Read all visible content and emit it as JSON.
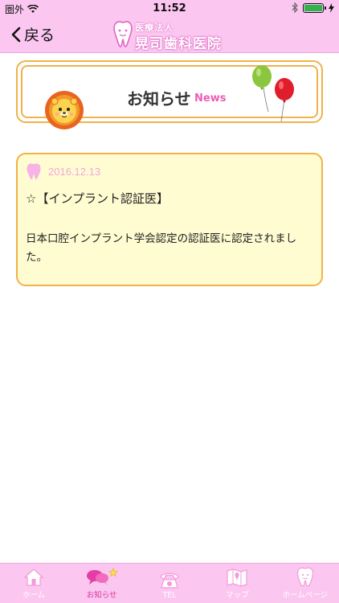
{
  "status_bar": {
    "carrier": "圏外",
    "time": "11:52"
  },
  "nav": {
    "back_label": "戻る",
    "logo_sub": "医療法人",
    "logo_main": "晃司歯科医院"
  },
  "banner": {
    "title": "お知らせ",
    "subtitle": "News"
  },
  "news": [
    {
      "date": "2016.12.13",
      "headline": "☆【インプラント認証医】",
      "body": "日本口腔インプラント学会認定の認証医に認定されました。"
    }
  ],
  "tabs": [
    {
      "label": "ホーム",
      "icon": "house-icon",
      "active": false
    },
    {
      "label": "お知らせ",
      "icon": "speech-bubbles-icon",
      "active": true
    },
    {
      "label": "TEL",
      "icon": "telephone-icon",
      "active": false
    },
    {
      "label": "マップ",
      "icon": "map-icon",
      "active": false
    },
    {
      "label": "ホームページ",
      "icon": "tooth-icon",
      "active": false
    }
  ],
  "colors": {
    "bar_pink": "#fbc6f0",
    "accent_pink": "#ec5db5",
    "border_orange": "#f0b24a",
    "card_yellow": "#fffcd2"
  }
}
